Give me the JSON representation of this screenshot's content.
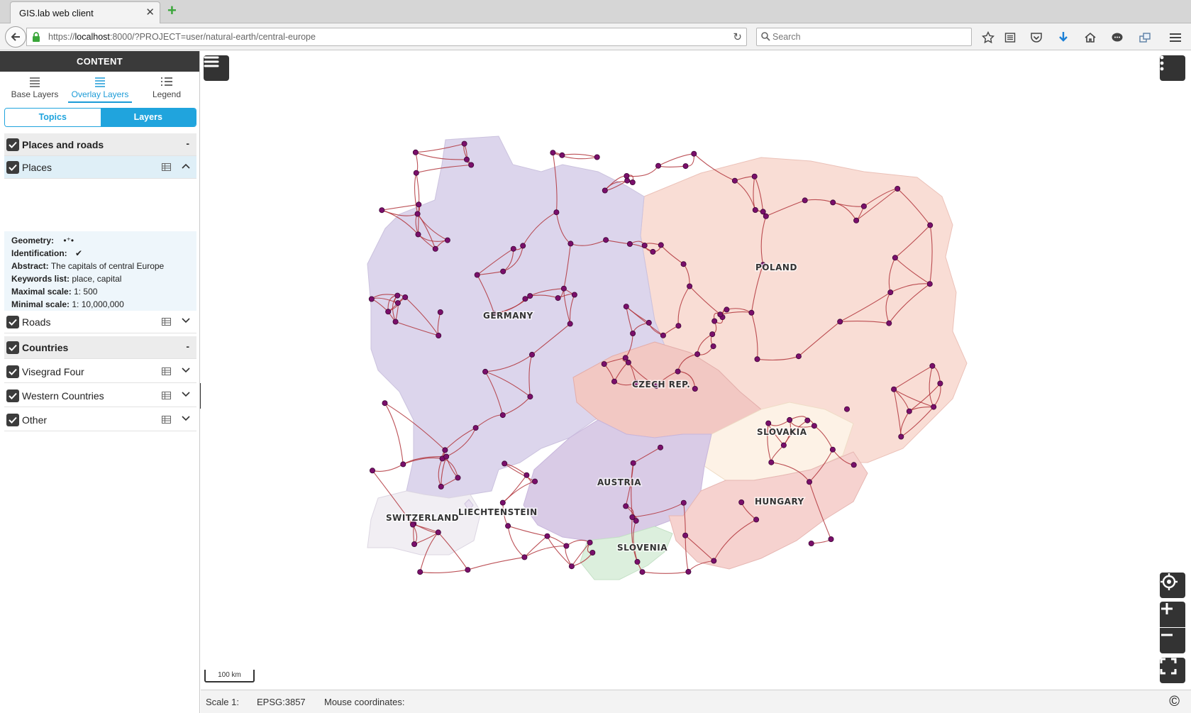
{
  "browser": {
    "tab_title": "GIS.lab web client",
    "tab_close": "✕",
    "new_tab": "+",
    "url_prefix": "https://",
    "url_host": "localhost",
    "url_rest": ":8000/?PROJECT=user/natural-earth/central-europe",
    "search_placeholder": "Search"
  },
  "sidebar": {
    "title": "CONTENT",
    "tabs": [
      {
        "label": "Base Layers",
        "active": false
      },
      {
        "label": "Overlay Layers",
        "active": true
      },
      {
        "label": "Legend",
        "active": false
      }
    ],
    "subtabs": [
      {
        "label": "Topics",
        "active": false
      },
      {
        "label": "Layers",
        "active": true
      }
    ],
    "groups": [
      {
        "label": "Places and roads",
        "collapse": "-",
        "layers": [
          {
            "label": "Places",
            "expanded": true
          },
          {
            "label": "Roads",
            "expanded": false
          }
        ]
      },
      {
        "label": "Countries",
        "collapse": "-",
        "layers": [
          {
            "label": "Visegrad Four",
            "expanded": false
          },
          {
            "label": "Western Countries",
            "expanded": false
          },
          {
            "label": "Other",
            "expanded": false
          }
        ]
      }
    ],
    "details": {
      "geometry_label": "Geometry:",
      "geometry_value": "•⁺•",
      "identification_label": "Identification:",
      "identification_value": "✔",
      "abstract_label": "Abstract:",
      "abstract_value": "The capitals of central Europe",
      "keywords_label": "Keywords list:",
      "keywords_value": "place, capital",
      "maxscale_label": "Maximal scale:",
      "maxscale_value": "1: 500",
      "minscale_label": "Minimal scale:",
      "minscale_value": "1: 10,000,000"
    }
  },
  "map": {
    "country_labels": [
      "GERMANY",
      "POLAND",
      "CZECH REP.",
      "SLOVAKIA",
      "AUSTRIA",
      "HUNGARY",
      "SWITZERLAND",
      "LIECHTENSTEIN",
      "SLOVENIA"
    ],
    "scale_bar": "100 km",
    "colors": {
      "germany": "#dcd5ec",
      "poland": "#f9ddd5",
      "czech": "#f2c8c3",
      "slovakia": "#fdf2e6",
      "austria": "#d9cbe6",
      "hungary": "#f6d2cf",
      "switzerland": "#f1eef3",
      "slovenia": "#dcefdd",
      "roads": "#b0323a",
      "places": "#7a0f6b"
    }
  },
  "status": {
    "scale_label": "Scale 1:",
    "epsg": "EPSG:3857",
    "mouse_label": "Mouse coordinates:",
    "copyright": "©"
  }
}
